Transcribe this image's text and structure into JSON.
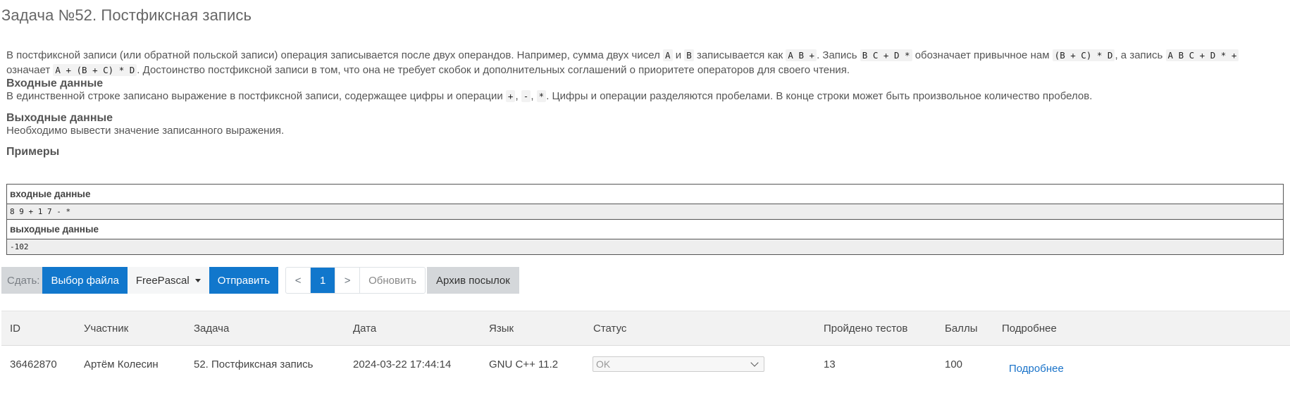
{
  "problem": {
    "title": "Задача №52. Постфиксная запись",
    "statement": {
      "t1": "В постфиксной записи (или обратной польской записи) операция записывается после двух операндов. Например, сумма двух чисел ",
      "c1": "A",
      "t2": " и ",
      "c2": "B",
      "t3": " записывается как ",
      "c3": "A B +",
      "t4": ". Запись ",
      "c4": "B C + D *",
      "t5": " обозначает привычное нам ",
      "c5": "(B + C) * D",
      "t6": ", а запись ",
      "c6": "A B C + D * +",
      "t7": " означает ",
      "c7": "A + (B + C) * D",
      "t8": ". Достоинство постфиксной записи в том, что она не требует скобок и дополнительных соглашений о приоритете операторов для своего чтения."
    },
    "input": {
      "heading": "Входные данные",
      "t1": "В единственной строке записано выражение в постфиксной записи, содержащее цифры и операции ",
      "c1": "+",
      "t2": ", ",
      "c2": "-",
      "t3": ", ",
      "c3": "*",
      "t4": ". Цифры и операции разделяются пробелами. В конце строки может быть произвольное количество пробелов."
    },
    "output": {
      "heading": "Выходные данные",
      "text": "Необходимо вывести значение записанного выражения."
    },
    "examples": {
      "heading": "Примеры",
      "input_label": "входные данные",
      "input_value": "8 9 + 1 7 - *",
      "output_label": "выходные данные",
      "output_value": "-102"
    }
  },
  "toolbar": {
    "submit_label": "Сдать:",
    "choose_file": "Выбор файла",
    "language": "FreePascal",
    "send": "Отправить",
    "prev": "<",
    "page": "1",
    "next": ">",
    "refresh": "Обновить",
    "archive": "Архив посылок"
  },
  "submissions": {
    "columns": [
      "ID",
      "Участник",
      "Задача",
      "Дата",
      "Язык",
      "Статус",
      "Пройдено тестов",
      "Баллы",
      "Подробнее"
    ],
    "rows": [
      {
        "id": "36462870",
        "participant": "Артём Колесин",
        "task": "52. Постфиксная запись",
        "date": "2024-03-22 17:44:14",
        "language": "GNU C++ 11.2",
        "status": "OK",
        "tests": "13",
        "score": "100",
        "details": "Подробнее"
      }
    ]
  },
  "colors": {
    "primary": "#1177cc",
    "secondary": "#d4d7da",
    "link": "#1a73c9"
  }
}
